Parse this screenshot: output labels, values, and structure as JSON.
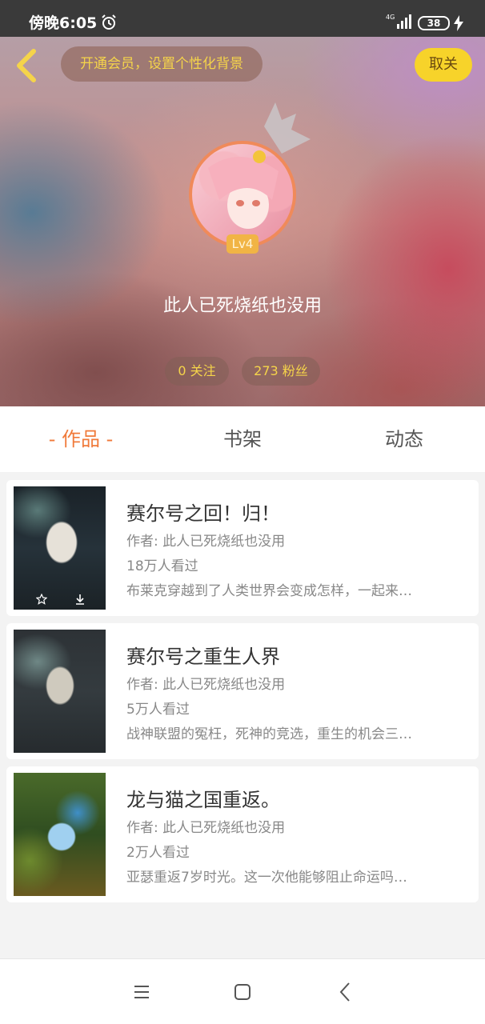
{
  "status_bar": {
    "time": "傍晚6:05",
    "network": "4G",
    "battery": "38"
  },
  "header": {
    "vip_banner": "开通会员，设置个性化背景",
    "unfollow_label": "取关",
    "level": "Lv4",
    "username": "此人已死烧纸也没用",
    "follow_count": "0 关注",
    "fans_count": "273 粉丝"
  },
  "tabs": [
    {
      "label": "- 作品 -",
      "active": true
    },
    {
      "label": "书架",
      "active": false
    },
    {
      "label": "动态",
      "active": false
    }
  ],
  "books": [
    {
      "title": "赛尔号之回！归！",
      "author": "作者: 此人已死烧纸也没用",
      "views": "18万人看过",
      "desc": "布莱克穿越到了人类世界会变成怎样，一起来…"
    },
    {
      "title": "赛尔号之重生人界",
      "author": "作者: 此人已死烧纸也没用",
      "views": "5万人看过",
      "desc": "战神联盟的冤枉，死神的竞选，重生的机会三…"
    },
    {
      "title": "龙与猫之国重返。",
      "author": "作者: 此人已死烧纸也没用",
      "views": "2万人看过",
      "desc": "亚瑟重返7岁时光。这一次他能够阻止命运吗…"
    }
  ],
  "colors": {
    "accent": "#f07a3a",
    "gold": "#f5d44a",
    "unfollow_bg": "#f7d32a",
    "level_badge": "#f1b445"
  }
}
